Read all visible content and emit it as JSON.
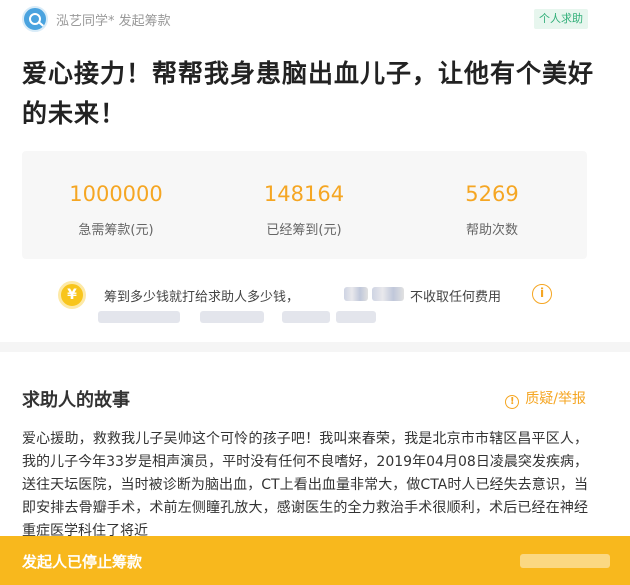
{
  "header": {
    "publisher": "泓艺同学* 发起筹款",
    "badge": "个人求助"
  },
  "title": "爱心接力！帮帮我身患脑出血儿子，让他有个美好的未来！",
  "stats": [
    {
      "value": "1000000",
      "label": "急需筹款(元)"
    },
    {
      "value": "148164",
      "label": "已经筹到(元)"
    },
    {
      "value": "5269",
      "label": "帮助次数"
    }
  ],
  "notice": {
    "text": "筹到多少钱就打给求助人多少钱，",
    "text2": "不收取任何费用",
    "yen": "¥",
    "info": "i"
  },
  "story": {
    "heading": "求助人的故事",
    "report_label": "质疑/举报",
    "report_icon": "!",
    "body": "爱心援助，救救我儿子吴帅这个可怜的孩子吧！我叫来春荣，我是北京市市辖区昌平区人，我的儿子今年33岁是相声演员，平时没有任何不良嗜好，2019年04月08日凌晨突发疾病，送往天坛医院，当时被诊断为脑出血，CT上看出血量非常大，做CTA时人已经失去意识，当即安排去骨瓣手术，术前左侧瞳孔放大，感谢医生的全力救治手术很顺利，术后已经在神经重症医学科住了将近"
  },
  "footer": {
    "status": "发起人已停止筹款"
  },
  "icons": {
    "avatar": "avatar-icon",
    "yen": "yen-coin-icon",
    "info": "info-icon",
    "report": "warning-icon"
  },
  "colors": {
    "accent": "#f5a623",
    "badge_text": "#33b07a",
    "bottom_bar": "#f8b81d"
  }
}
